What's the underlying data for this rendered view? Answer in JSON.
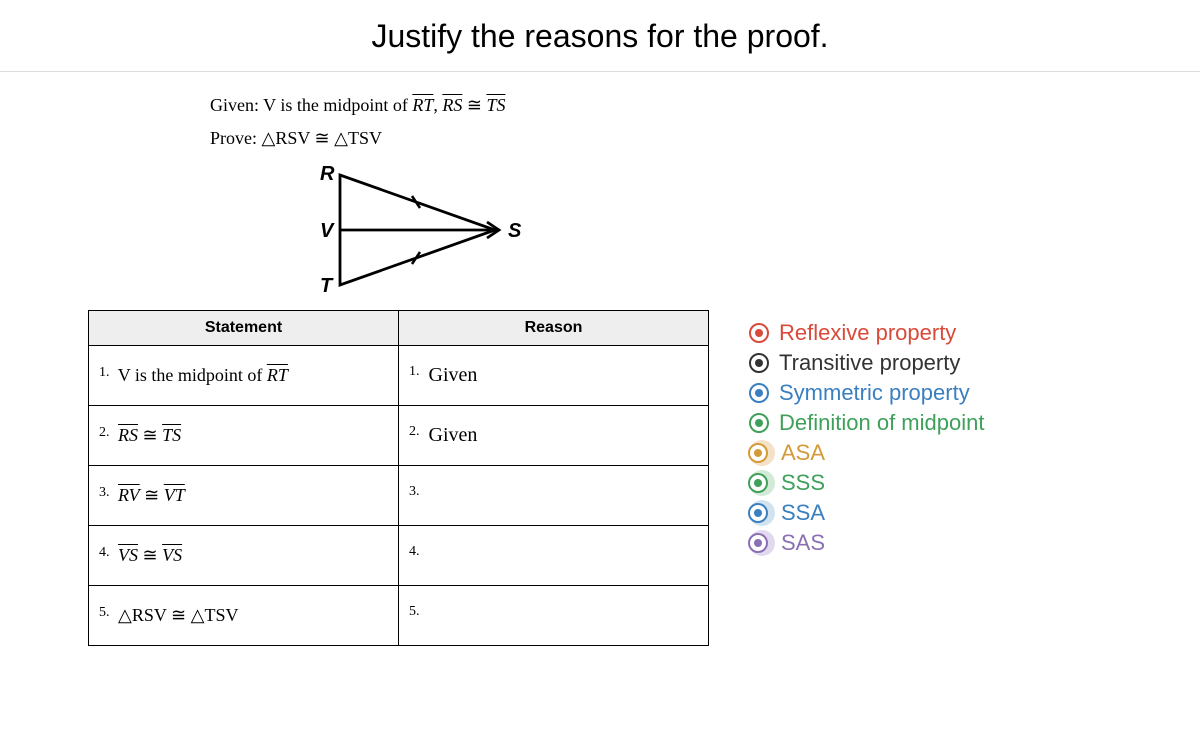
{
  "title": "Justify the reasons for the proof.",
  "given_prefix": "Given: V is the midpoint of ",
  "given_seg": "RT",
  "given_comma": ", ",
  "given_rs": "RS",
  "given_cong": " ≅ ",
  "given_ts": "TS",
  "prove_prefix": "Prove:  ",
  "prove_lhs": "△RSV",
  "prove_cong": " ≅ ",
  "prove_rhs": "△TSV",
  "figure_labels": {
    "R": "R",
    "V": "V",
    "T": "T",
    "S": "S"
  },
  "headers": {
    "stmt": "Statement",
    "reason": "Reason"
  },
  "rows": [
    {
      "n": "1.",
      "stmt_pre": "V is the midpoint of ",
      "stmt_seg1": "RT",
      "stmt_mid": "",
      "stmt_seg2": "",
      "reason_n": "1.",
      "reason": "Given"
    },
    {
      "n": "2.",
      "stmt_pre": "",
      "stmt_seg1": "RS",
      "stmt_mid": " ≅ ",
      "stmt_seg2": "TS",
      "reason_n": "2.",
      "reason": "Given"
    },
    {
      "n": "3.",
      "stmt_pre": "",
      "stmt_seg1": "RV",
      "stmt_mid": " ≅ ",
      "stmt_seg2": "VT",
      "reason_n": "3.",
      "reason": ""
    },
    {
      "n": "4.",
      "stmt_pre": "",
      "stmt_seg1": "VS",
      "stmt_mid": " ≅ ",
      "stmt_seg2": "VS",
      "reason_n": "4.",
      "reason": ""
    },
    {
      "n": "5.",
      "stmt_pre": "△RSV ≅ △TSV",
      "stmt_seg1": "",
      "stmt_mid": "",
      "stmt_seg2": "",
      "reason_n": "5.",
      "reason": ""
    }
  ],
  "options": [
    {
      "label": "Reflexive property",
      "color": "#d94a3a",
      "halo": ""
    },
    {
      "label": "Transitive property",
      "color": "#333333",
      "halo": ""
    },
    {
      "label": "Symmetric property",
      "color": "#3a7fbf",
      "halo": ""
    },
    {
      "label": "Definition of midpoint",
      "color": "#3fa05a",
      "halo": ""
    },
    {
      "label": "ASA",
      "color": "#d49a3a",
      "halo": "#f3e2c8"
    },
    {
      "label": "SSS",
      "color": "#3fa05a",
      "halo": "#d2ead7"
    },
    {
      "label": "SSA",
      "color": "#3a7fbf",
      "halo": "#d2e3f0"
    },
    {
      "label": "SAS",
      "color": "#8a6fb5",
      "halo": "#e2d9ef"
    }
  ]
}
